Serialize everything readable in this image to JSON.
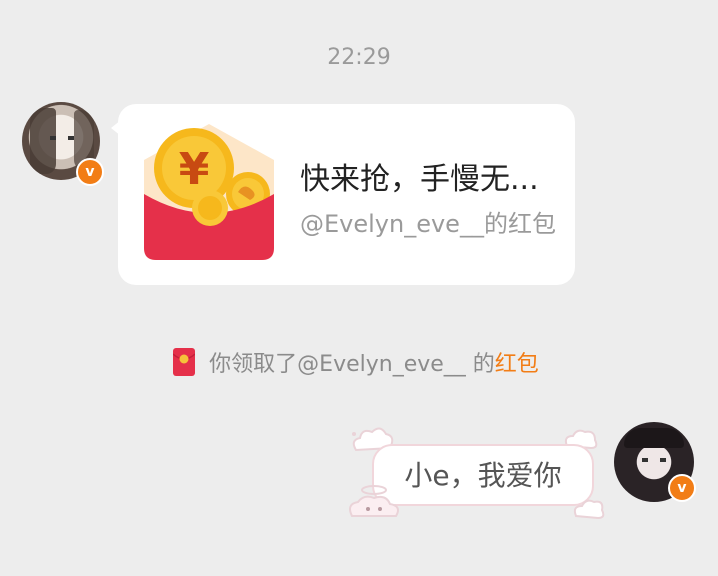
{
  "chat": {
    "timestamp": "22:29",
    "red_packet": {
      "title": "快来抢，手慢无...",
      "subtitle": "@Evelyn_eve__的红包",
      "icon": "red-packet-icon"
    },
    "notice": {
      "text": "你领取了@Evelyn_eve__ 的",
      "link": "红包"
    },
    "my_message": {
      "text": "小e，我爱你"
    },
    "left_avatar_badge": "v",
    "right_avatar_badge": "v"
  },
  "colors": {
    "background": "#ededed",
    "accent": "#f27d16",
    "packet_red": "#e5304a",
    "coin_gold": "#f6b81c"
  }
}
